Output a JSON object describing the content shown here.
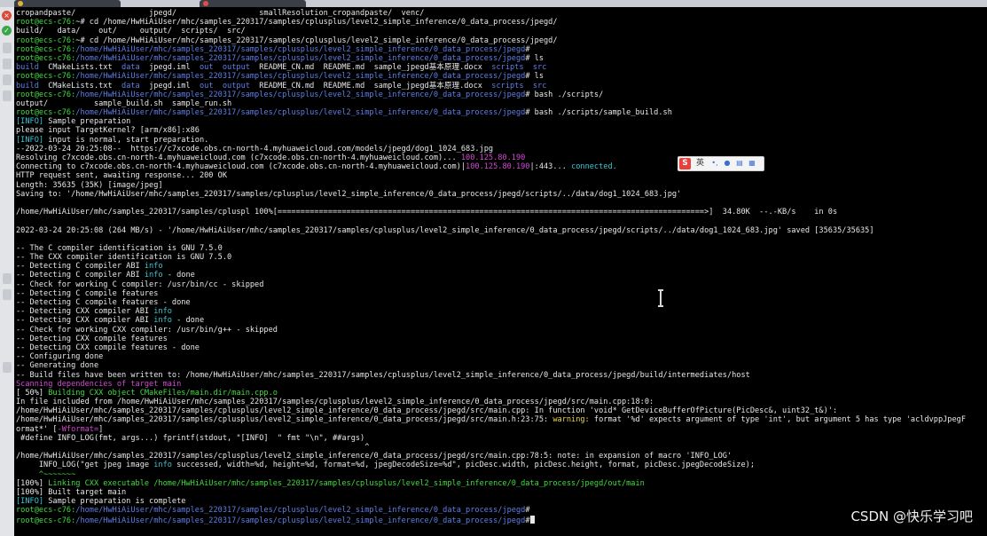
{
  "watermark": "CSDN @快乐学习吧",
  "ime": {
    "logo": "S",
    "lang": "英",
    "icons": [
      "punctuation-icon",
      "microphone-icon",
      "keyboard-icon",
      "grid-icon"
    ]
  },
  "colors": {
    "background": "#000000",
    "prompt": "#3ede3e",
    "path": "#5f7fe8",
    "dir": "#5f7fe8",
    "info": "#36c8d4",
    "scan": "#d24ad2",
    "warning": "#e8d44a",
    "error": "#e84a4a"
  },
  "terminal_lines": [
    [
      {
        "c": "white",
        "t": "cropandpaste/                jpegd/                  smallResolution_cropandpaste/  venc/"
      }
    ],
    [
      {
        "c": "green",
        "t": "root@ecs-c76:"
      },
      {
        "c": "white",
        "t": "~# cd /home/HwHiAiUser/mhc/samples_220317/samples/cplusplus/level2_simple_inference/0_data_process/jpegd/"
      }
    ],
    [
      {
        "c": "white",
        "t": "build/   data/    out/     output/  scripts/  src/"
      }
    ],
    [
      {
        "c": "green",
        "t": "root@ecs-c76:"
      },
      {
        "c": "white",
        "t": "~# cd /home/HwHiAiUser/mhc/samples_220317/samples/cplusplus/level2_simple_inference/0_data_process/jpegd/"
      }
    ],
    [
      {
        "c": "green",
        "t": "root@ecs-c76:"
      },
      {
        "c": "blue",
        "t": "/home/HwHiAiUser/mhc/samples_220317/samples/cplusplus/level2_simple_inference/0_data_process/jpegd"
      },
      {
        "c": "white",
        "t": "#"
      }
    ],
    [
      {
        "c": "green",
        "t": "root@ecs-c76:"
      },
      {
        "c": "blue",
        "t": "/home/HwHiAiUser/mhc/samples_220317/samples/cplusplus/level2_simple_inference/0_data_process/jpegd"
      },
      {
        "c": "white",
        "t": "# ls"
      }
    ],
    [
      {
        "c": "blue",
        "t": "build"
      },
      {
        "c": "white",
        "t": "  CMakeLists.txt  "
      },
      {
        "c": "blue",
        "t": "data"
      },
      {
        "c": "white",
        "t": "  jpegd.iml  "
      },
      {
        "c": "blue",
        "t": "out"
      },
      {
        "c": "white",
        "t": "  "
      },
      {
        "c": "blue",
        "t": "output"
      },
      {
        "c": "white",
        "t": "  README_CN.md  README.md  sample_jpegd基本原理.docx  "
      },
      {
        "c": "blue",
        "t": "scripts"
      },
      {
        "c": "white",
        "t": "  "
      },
      {
        "c": "blue",
        "t": "src"
      }
    ],
    [
      {
        "c": "green",
        "t": "root@ecs-c76:"
      },
      {
        "c": "blue",
        "t": "/home/HwHiAiUser/mhc/samples_220317/samples/cplusplus/level2_simple_inference/0_data_process/jpegd"
      },
      {
        "c": "white",
        "t": "# ls"
      }
    ],
    [
      {
        "c": "blue",
        "t": "build"
      },
      {
        "c": "white",
        "t": "  CMakeLists.txt  "
      },
      {
        "c": "blue",
        "t": "data"
      },
      {
        "c": "white",
        "t": "  jpegd.iml  "
      },
      {
        "c": "blue",
        "t": "out"
      },
      {
        "c": "white",
        "t": "  "
      },
      {
        "c": "blue",
        "t": "output"
      },
      {
        "c": "white",
        "t": "  README_CN.md  README.md  sample_jpegd基本原理.docx  "
      },
      {
        "c": "blue",
        "t": "scripts"
      },
      {
        "c": "white",
        "t": "  "
      },
      {
        "c": "blue",
        "t": "src"
      }
    ],
    [
      {
        "c": "green",
        "t": "root@ecs-c76:"
      },
      {
        "c": "blue",
        "t": "/home/HwHiAiUser/mhc/samples_220317/samples/cplusplus/level2_simple_inference/0_data_process/jpegd"
      },
      {
        "c": "white",
        "t": "# bash ./scripts/"
      }
    ],
    [
      {
        "c": "white",
        "t": "output/          sample_build.sh  sample_run.sh"
      }
    ],
    [
      {
        "c": "green",
        "t": "root@ecs-c76:"
      },
      {
        "c": "blue",
        "t": "/home/HwHiAiUser/mhc/samples_220317/samples/cplusplus/level2_simple_inference/0_data_process/jpegd"
      },
      {
        "c": "white",
        "t": "# bash ./scripts/sample_build.sh"
      }
    ],
    [
      {
        "c": "cyan",
        "t": "[INFO]"
      },
      {
        "c": "white",
        "t": " Sample preparation"
      }
    ],
    [
      {
        "c": "white",
        "t": "please input TargetKernel? [arm/x86]:x86"
      }
    ],
    [
      {
        "c": "cyan",
        "t": "[INFO]"
      },
      {
        "c": "white",
        "t": " input is normal, start preparation."
      }
    ],
    [
      {
        "c": "white",
        "t": "--2022-03-24 20:25:08--  https://c7xcode.obs.cn-north-4.myhuaweicloud.com/models/jpegd/dog1_1024_683.jpg"
      }
    ],
    [
      {
        "c": "white",
        "t": "Resolving c7xcode.obs.cn-north-4.myhuaweicloud.com (c7xcode.obs.cn-north-4.myhuaweicloud.com)... "
      },
      {
        "c": "magenta",
        "t": "100.125.80.190"
      }
    ],
    [
      {
        "c": "white",
        "t": "Connecting to c7xcode.obs.cn-north-4.myhuaweicloud.com (c7xcode.obs.cn-north-4.myhuaweicloud.com)|"
      },
      {
        "c": "magenta",
        "t": "100.125.80.190"
      },
      {
        "c": "white",
        "t": "|:443... "
      },
      {
        "c": "cyan",
        "t": "connected."
      }
    ],
    [
      {
        "c": "white",
        "t": "HTTP request sent, awaiting response... 200 OK"
      }
    ],
    [
      {
        "c": "white",
        "t": "Length: 35635 (35K) [image/jpeg]"
      }
    ],
    [
      {
        "c": "white",
        "t": "Saving to: '/home/HwHiAiUser/mhc/samples_220317/samples/cplusplus/level2_simple_inference/0_data_process/jpegd/scripts/../data/dog1_1024_683.jpg'"
      }
    ],
    [
      {
        "c": "white",
        "t": ""
      }
    ],
    [
      {
        "c": "white",
        "t": "/home/HwHiAiUser/mhc/samples_220317/samples/cpluspl 100%[=============================================================================================>]  34.80K  --.-KB/s    in 0s"
      }
    ],
    [
      {
        "c": "white",
        "t": ""
      }
    ],
    [
      {
        "c": "white",
        "t": "2022-03-24 20:25:08 (264 MB/s) - '/home/HwHiAiUser/mhc/samples_220317/samples/cplusplus/level2_simple_inference/0_data_process/jpegd/scripts/../data/dog1_1024_683.jpg' saved [35635/35635]"
      }
    ],
    [
      {
        "c": "white",
        "t": ""
      }
    ],
    [
      {
        "c": "white",
        "t": "-- The C compiler identification is GNU 7.5.0"
      }
    ],
    [
      {
        "c": "white",
        "t": "-- The CXX compiler identification is GNU 7.5.0"
      }
    ],
    [
      {
        "c": "white",
        "t": "-- Detecting C compiler ABI "
      },
      {
        "c": "cyan",
        "t": "info"
      }
    ],
    [
      {
        "c": "white",
        "t": "-- Detecting C compiler ABI "
      },
      {
        "c": "cyan",
        "t": "info"
      },
      {
        "c": "white",
        "t": " - done"
      }
    ],
    [
      {
        "c": "white",
        "t": "-- Check for working C compiler: /usr/bin/cc - skipped"
      }
    ],
    [
      {
        "c": "white",
        "t": "-- Detecting C compile features"
      }
    ],
    [
      {
        "c": "white",
        "t": "-- Detecting C compile features - done"
      }
    ],
    [
      {
        "c": "white",
        "t": "-- Detecting CXX compiler ABI "
      },
      {
        "c": "cyan",
        "t": "info"
      }
    ],
    [
      {
        "c": "white",
        "t": "-- Detecting CXX compiler ABI "
      },
      {
        "c": "cyan",
        "t": "info"
      },
      {
        "c": "white",
        "t": " - done"
      }
    ],
    [
      {
        "c": "white",
        "t": "-- Check for working CXX compiler: /usr/bin/g++ - skipped"
      }
    ],
    [
      {
        "c": "white",
        "t": "-- Detecting CXX compile features"
      }
    ],
    [
      {
        "c": "white",
        "t": "-- Detecting CXX compile features - done"
      }
    ],
    [
      {
        "c": "white",
        "t": "-- Configuring done"
      }
    ],
    [
      {
        "c": "white",
        "t": "-- Generating done"
      }
    ],
    [
      {
        "c": "white",
        "t": "-- Build files have been written to: /home/HwHiAiUser/mhc/samples_220317/samples/cplusplus/level2_simple_inference/0_data_process/jpegd/build/intermediates/host"
      }
    ],
    [
      {
        "c": "magenta",
        "t": "Scanning dependencies of target main"
      }
    ],
    [
      {
        "c": "white",
        "t": "[ 50%] "
      },
      {
        "c": "green",
        "t": "Building CXX object CMakeFiles/main.dir/main.cpp.o"
      }
    ],
    [
      {
        "c": "white",
        "t": "In file included from /home/HwHiAiUser/mhc/samples_220317/samples/cplusplus/level2_simple_inference/0_data_process/jpegd/src/main.cpp:18:0:"
      }
    ],
    [
      {
        "c": "white",
        "t": "/home/HwHiAiUser/mhc/samples_220317/samples/cplusplus/level2_simple_inference/0_data_process/jpegd/src/main.cpp: In function 'void* GetDeviceBufferOfPicture(PicDesc&, uint32_t&)':"
      }
    ],
    [
      {
        "c": "white",
        "t": "/home/HwHiAiUser/mhc/samples_220317/samples/cplusplus/level2_simple_inference/0_data_process/jpegd/src/main.h:23:75: "
      },
      {
        "c": "yellow",
        "t": "warning:"
      },
      {
        "c": "white",
        "t": " format '%d' expects argument of type 'int', but argument 5 has type 'acldvppJpegF"
      }
    ],
    [
      {
        "c": "white",
        "t": "ormat*' ["
      },
      {
        "c": "magenta",
        "t": "-Wformat="
      },
      {
        "c": "white",
        "t": "]"
      }
    ],
    [
      {
        "c": "white",
        "t": " #define INFO_LOG(fmt, args...) fprintf(stdout, \"[INFO]  \" fmt \"\\n\", ##args)"
      }
    ],
    [
      {
        "c": "white",
        "t": "                                                                            ^"
      }
    ],
    [
      {
        "c": "white",
        "t": "/home/HwHiAiUser/mhc/samples_220317/samples/cplusplus/level2_simple_inference/0_data_process/jpegd/src/main.cpp:78:5: note: in expansion of macro 'INFO_LOG'"
      }
    ],
    [
      {
        "c": "white",
        "t": "     INFO_LOG(\"get jpeg image "
      },
      {
        "c": "cyan",
        "t": "info"
      },
      {
        "c": "white",
        "t": " successed, width=%d, height=%d, format=%d, jpegDecodeSize=%d\", picDesc.width, picDesc.height, format, picDesc.jpegDecodeSize);"
      }
    ],
    [
      {
        "c": "green",
        "t": "     ^~~~~~~~"
      }
    ],
    [
      {
        "c": "white",
        "t": "[100%] "
      },
      {
        "c": "green",
        "t": "Linking CXX executable /home/HwHiAiUser/mhc/samples_220317/samples/cplusplus/level2_simple_inference/0_data_process/jpegd/out/main"
      }
    ],
    [
      {
        "c": "white",
        "t": "[100%] Built target main"
      }
    ],
    [
      {
        "c": "cyan",
        "t": "[INFO]"
      },
      {
        "c": "white",
        "t": " Sample preparation is complete"
      }
    ],
    [
      {
        "c": "green",
        "t": "root@ecs-c76:"
      },
      {
        "c": "blue",
        "t": "/home/HwHiAiUser/mhc/samples_220317/samples/cplusplus/level2_simple_inference/0_data_process/jpegd"
      },
      {
        "c": "white",
        "t": "#"
      }
    ],
    [
      {
        "c": "green",
        "t": "root@ecs-c76:"
      },
      {
        "c": "blue",
        "t": "/home/HwHiAiUser/mhc/samples_220317/samples/cplusplus/level2_simple_inference/0_data_process/jpegd"
      },
      {
        "c": "white",
        "t": "#"
      }
    ]
  ]
}
